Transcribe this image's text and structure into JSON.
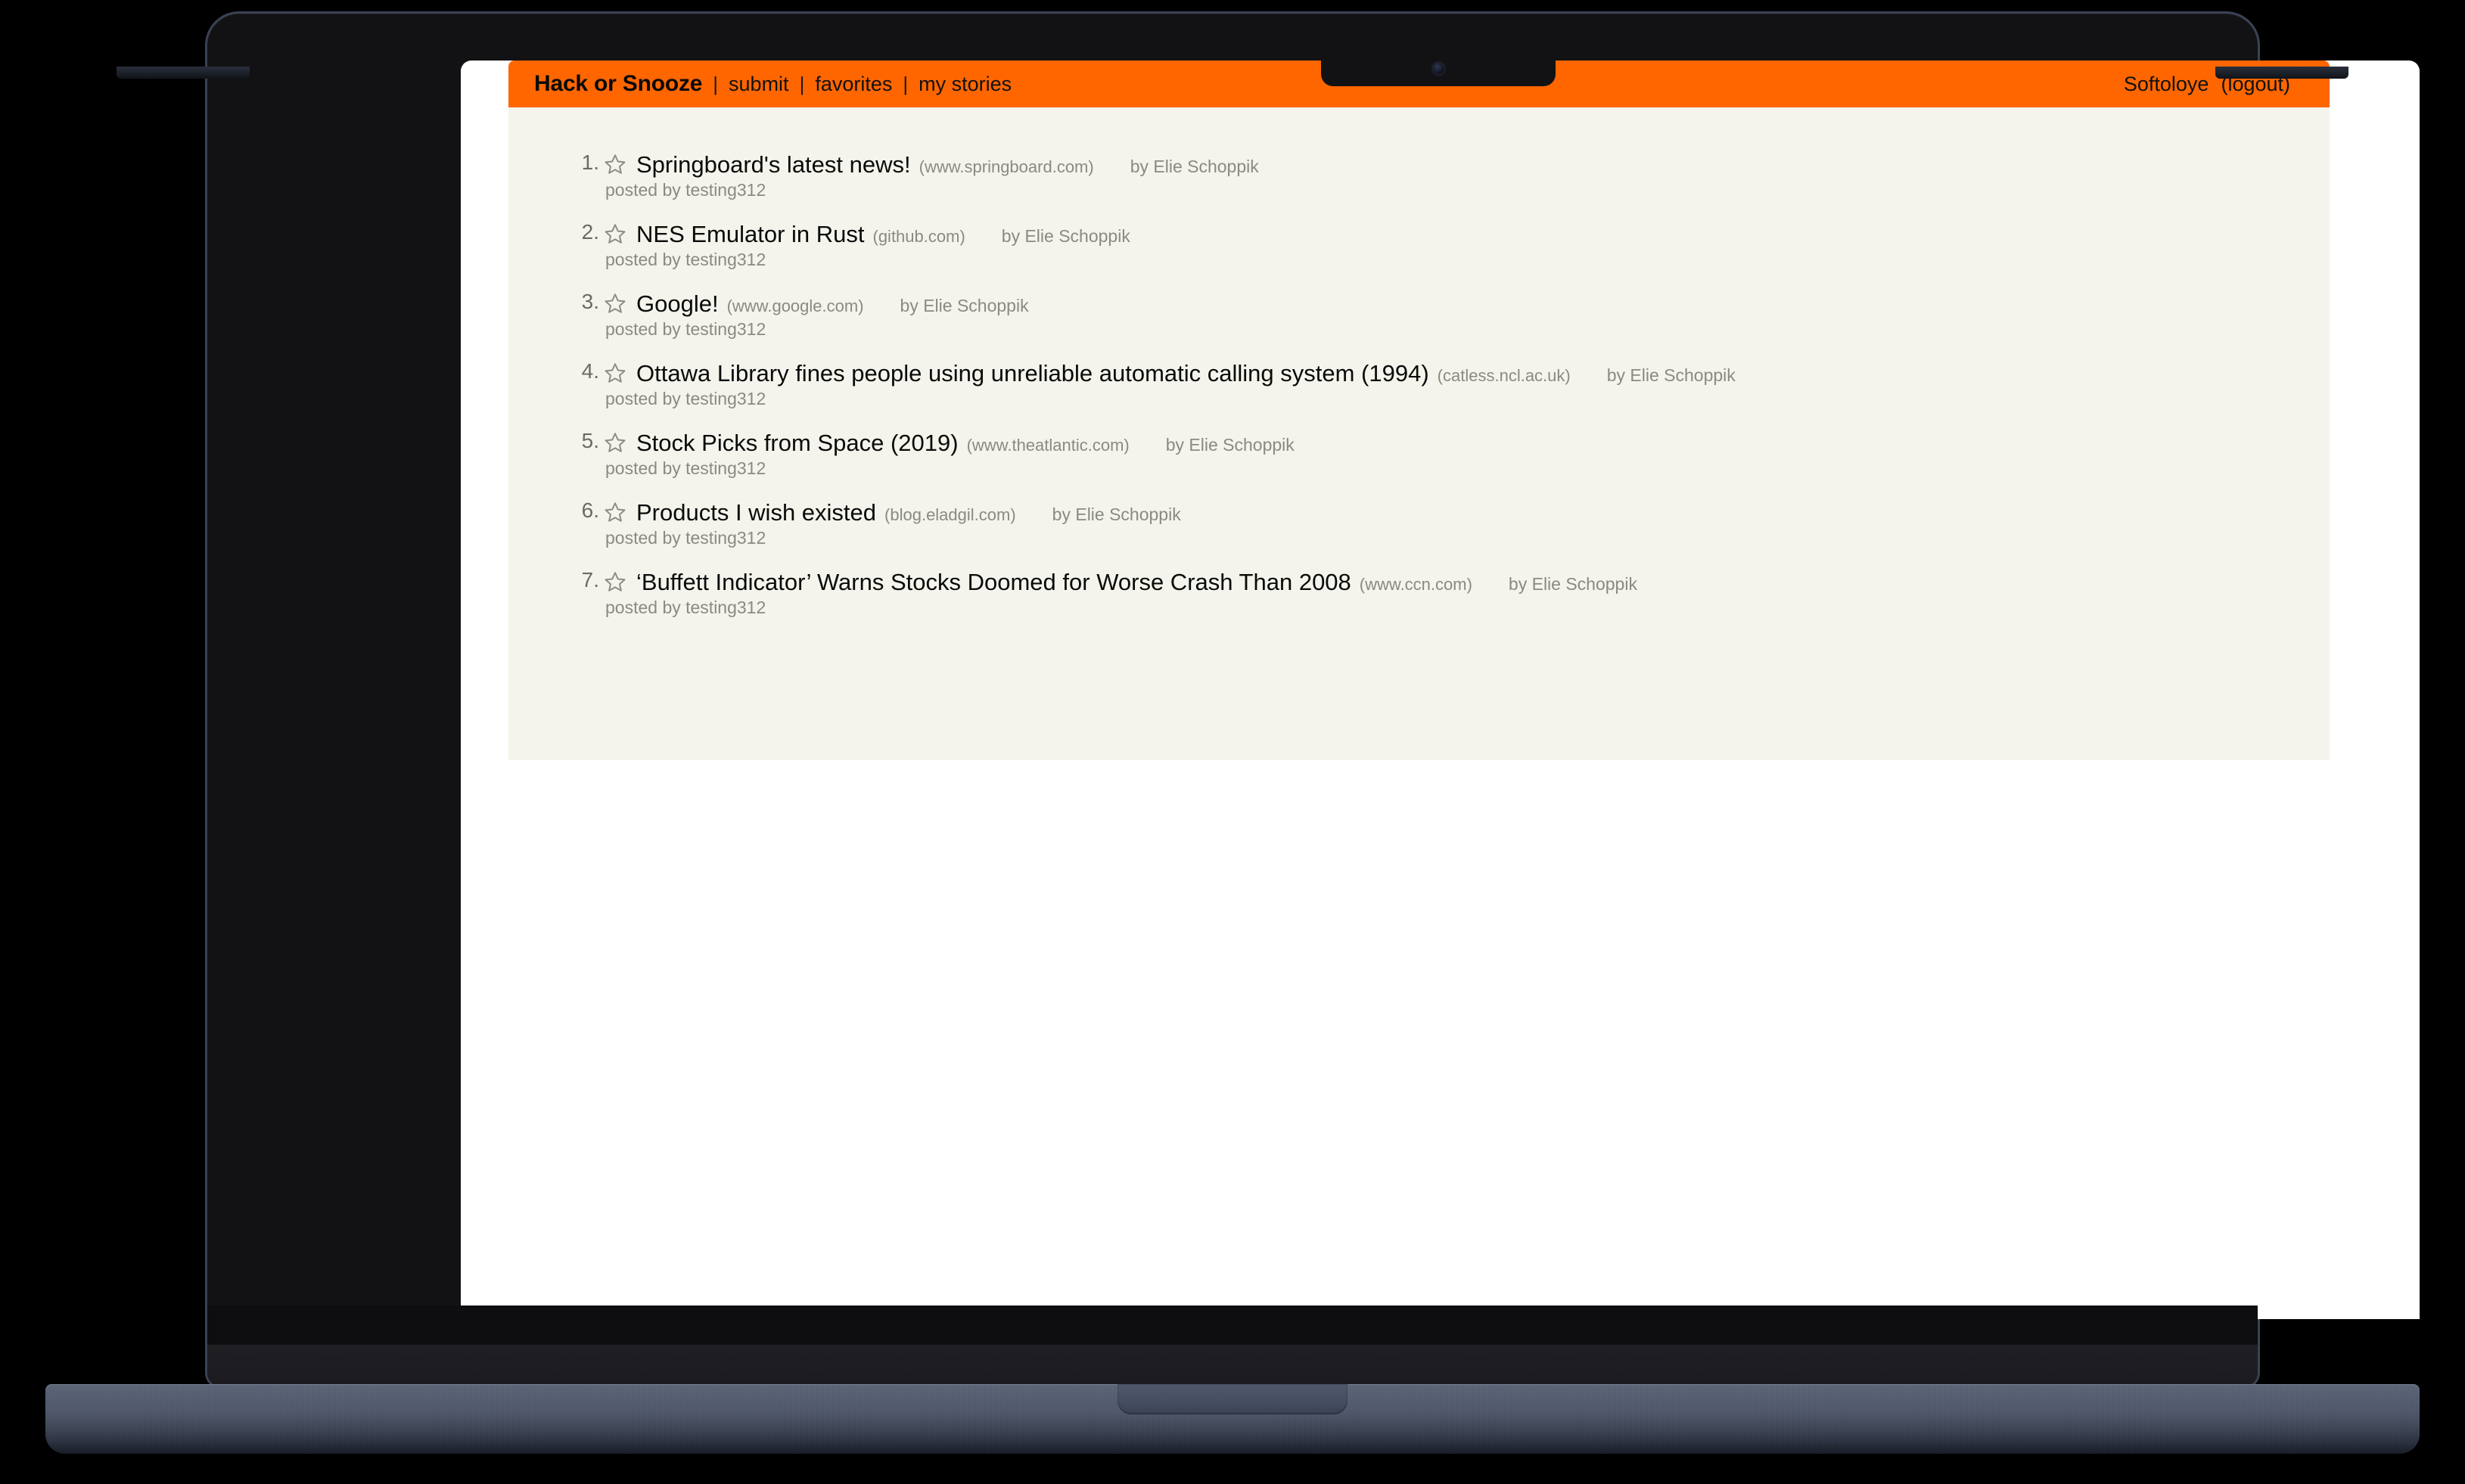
{
  "navbar": {
    "brand": "Hack or Snooze",
    "separator": "|",
    "links": [
      {
        "label": "submit"
      },
      {
        "label": "favorites"
      },
      {
        "label": "my stories"
      }
    ],
    "user": "Softoloye",
    "logout": "(logout)",
    "background_color": "#ff6600"
  },
  "page": {
    "background_color": "#f4f4ec",
    "star_icon": "star-outline-icon"
  },
  "stories": [
    {
      "index": "1.",
      "title": "Springboard's latest news!",
      "host": "(www.springboard.com)",
      "author": "by Elie Schoppik",
      "posted_by": "posted by testing312"
    },
    {
      "index": "2.",
      "title": "NES Emulator in Rust",
      "host": "(github.com)",
      "author": "by Elie Schoppik",
      "posted_by": "posted by testing312"
    },
    {
      "index": "3.",
      "title": "Google!",
      "host": "(www.google.com)",
      "author": "by Elie Schoppik",
      "posted_by": "posted by testing312"
    },
    {
      "index": "4.",
      "title": "Ottawa Library fines people using unreliable automatic calling system (1994)",
      "host": "(catless.ncl.ac.uk)",
      "author": "by Elie Schoppik",
      "posted_by": "posted by testing312"
    },
    {
      "index": "5.",
      "title": "Stock Picks from Space (2019)",
      "host": "(www.theatlantic.com)",
      "author": "by Elie Schoppik",
      "posted_by": "posted by testing312"
    },
    {
      "index": "6.",
      "title": "Products I wish existed",
      "host": "(blog.eladgil.com)",
      "author": "by Elie Schoppik",
      "posted_by": "posted by testing312"
    },
    {
      "index": "7.",
      "title": "‘Buffett Indicator’ Warns Stocks Doomed for Worse Crash Than 2008",
      "host": "(www.ccn.com)",
      "author": "by Elie Schoppik",
      "posted_by": "posted by testing312"
    }
  ]
}
